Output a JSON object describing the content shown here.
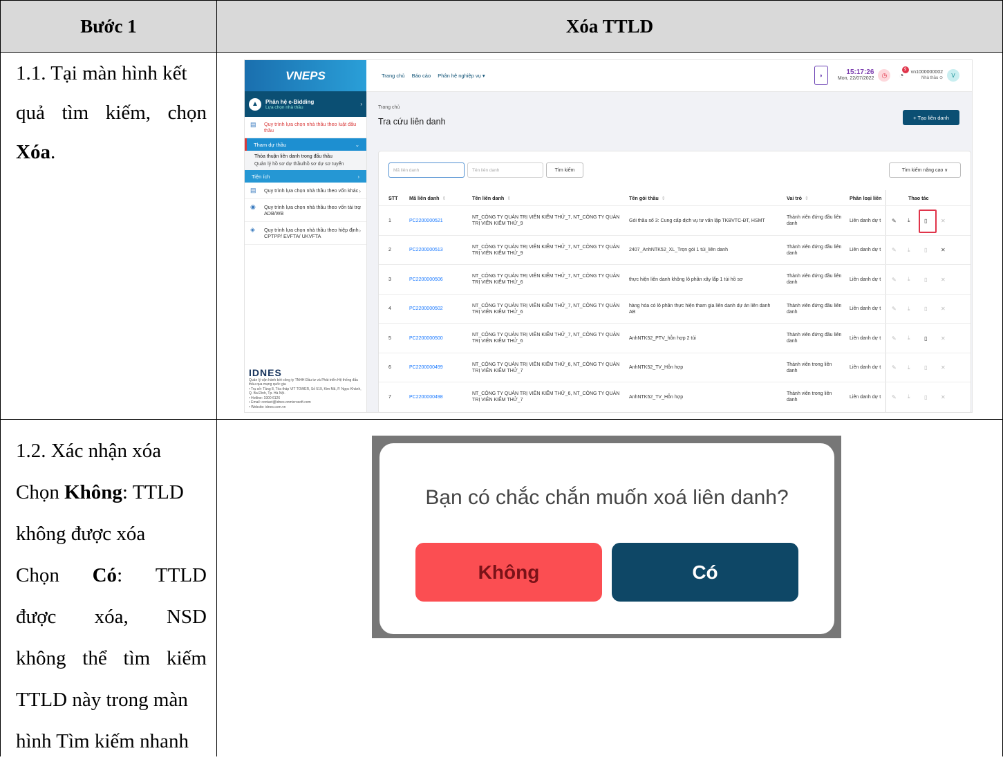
{
  "table": {
    "header_step": "Bước 1",
    "header_title": "Xóa TTLD"
  },
  "step1": {
    "line1": "1.1. Tại màn hình kết",
    "line2a": "quả",
    "line2b": "tìm",
    "line2c": "kiếm,",
    "line2d": "chọn",
    "bold": "Xóa",
    "tail": "."
  },
  "step2": {
    "line1": "1.2. Xác nhận xóa",
    "no_prefix": "Chọn ",
    "no_bold": "Không",
    "no_rest": ": TTLD",
    "no_line2": "không được xóa",
    "yes_a": "Chọn",
    "yes_b": "Có",
    "yes_c": ": ",
    "yes_d": "TTLD",
    "yes_line2a": "được",
    "yes_line2b": "xóa,",
    "yes_line2c": "NSD",
    "yes_line3a": "không",
    "yes_line3b": "thể",
    "yes_line3c": "tìm",
    "yes_line3d": "kiếm",
    "yes_line4": "TTLD này trong màn",
    "yes_line5": "hình Tìm kiếm nhanh"
  },
  "app": {
    "logo": "VNEPS",
    "module_title": "Phân hệ e-Bidding",
    "module_sub": "Lựa chọn nhà thầu",
    "side_items": [
      "Quy trình lựa chọn nhà thầu theo luật đấu thầu",
      "Quy trình lựa chọn nhà thầu theo vốn khác",
      "Quy trình lựa chọn nhà thầu theo vốn tài trợ ADB/WB",
      "Quy trình lựa chọn nhà thầu theo hiệp định CPTPP/ EVFTA/ UKVFTA"
    ],
    "bar1": "Tham dự thầu",
    "sub1": "Thỏa thuận liên danh trong đấu thầu",
    "sub2": "Quản lý hồ sơ dự thầu/hồ sơ dự sơ tuyển",
    "bar2": "Tiện ích",
    "footer_brand": "IDNES",
    "footer_lines": [
      "Quản lý vận hành bởi công ty TNHH Đầu tư và Phát triển Hệ thống đấu thầu qua mạng quốc gia",
      "• Trụ sở: Tầng 8, Tòa tháp VIT TOWER, Số 519, Kim Mã, P. Ngọc Khánh, Q. Ba Đình, Tp. Hà Nội.",
      "• Hotline: 1900 6126",
      "• Email: contact@idnes.onmicrosoft.com",
      "• Website: idnes.com.vn"
    ],
    "nav": [
      "Trang chủ",
      "Báo cáo",
      "Phân hệ nghiệp vụ ▾"
    ],
    "time": "15:17:26",
    "date": "Mon, 22/07/2022",
    "notif_count": "9",
    "user": "vn1000000002",
    "user_role": "Nhà thầu ⊙",
    "avatar": "V",
    "breadcrumb": "Trang chủ",
    "page_title": "Tra cứu liên danh",
    "create_btn": "+  Tạo liên danh",
    "ph_code": "Mã liên danh",
    "ph_name": "Tên liên danh",
    "search_btn": "Tìm kiếm",
    "adv_search": "Tìm kiếm nâng cao ∨",
    "columns": [
      "STT",
      "Mã liên danh",
      "Tên liên danh",
      "Tên gói thầu",
      "Vai trò",
      "Phân loại liên",
      "Thao tác"
    ],
    "rows": [
      {
        "stt": "1",
        "code": "PC2200000521",
        "name": "NT_CÔNG TY QUẢN TRỊ VIÊN KIỂM THỬ_7, NT_CÔNG TY QUẢN TRỊ VIÊN KIỂM THỬ_9",
        "pkg": "Gói thầu số 3: Cung cấp dịch vụ tư vấn lập TKBVTC-ĐT, HSMT",
        "role": "Thành viên đứng đầu liên danh",
        "type": "Liên danh dự t"
      },
      {
        "stt": "2",
        "code": "PC2200000513",
        "name": "NT_CÔNG TY QUẢN TRỊ VIÊN KIỂM THỬ_7, NT_CÔNG TY QUẢN TRỊ VIÊN KIỂM THỬ_9",
        "pkg": "2407_AnhNTK52_XL_Trọn gói 1 túi_liên danh",
        "role": "Thành viên đứng đầu liên danh",
        "type": "Liên danh dự t"
      },
      {
        "stt": "3",
        "code": "PC2200000506",
        "name": "NT_CÔNG TY QUẢN TRỊ VIÊN KIỂM THỬ_7, NT_CÔNG TY QUẢN TRỊ VIÊN KIỂM THỬ_6",
        "pkg": "thực hiện liên danh không lô phần xây lắp 1 túi hồ sơ",
        "role": "Thành viên đứng đầu liên danh",
        "type": "Liên danh dự t"
      },
      {
        "stt": "4",
        "code": "PC2200000502",
        "name": "NT_CÔNG TY QUẢN TRỊ VIÊN KIỂM THỬ_7, NT_CÔNG TY QUẢN TRỊ VIÊN KIỂM THỬ_6",
        "pkg": "hàng hóa có lô phần thực hiện tham gia liên danh dự án liên danh AB",
        "role": "Thành viên đứng đầu liên danh",
        "type": "Liên danh dự t"
      },
      {
        "stt": "5",
        "code": "PC2200000500",
        "name": "NT_CÔNG TY QUẢN TRỊ VIÊN KIỂM THỬ_7, NT_CÔNG TY QUẢN TRỊ VIÊN KIỂM THỬ_6",
        "pkg": "AnhNTK52_PTV_hỗn hợp 2 túi",
        "role": "Thành viên đứng đầu liên danh",
        "type": "Liên danh dự t"
      },
      {
        "stt": "6",
        "code": "PC2200000499",
        "name": "NT_CÔNG TY QUẢN TRỊ VIÊN KIỂM THỬ_6, NT_CÔNG TY QUẢN TRỊ VIÊN KIỂM THỬ_7",
        "pkg": "AnhNTK52_TV_Hỗn hợp",
        "role": "Thành viên trong liên danh",
        "type": "Liên danh dự t"
      },
      {
        "stt": "7",
        "code": "PC2200000498",
        "name": "NT_CÔNG TY QUẢN TRỊ VIÊN KIỂM THỬ_6, NT_CÔNG TY QUẢN TRỊ VIÊN KIỂM THỬ_7",
        "pkg": "AnhNTK52_TV_Hỗn hợp",
        "role": "Thành viên trong liên danh",
        "type": "Liên danh dự t"
      }
    ]
  },
  "dialog": {
    "question": "Bạn có chắc chắn muốn xoá liên danh?",
    "no": "Không",
    "yes": "Có"
  }
}
